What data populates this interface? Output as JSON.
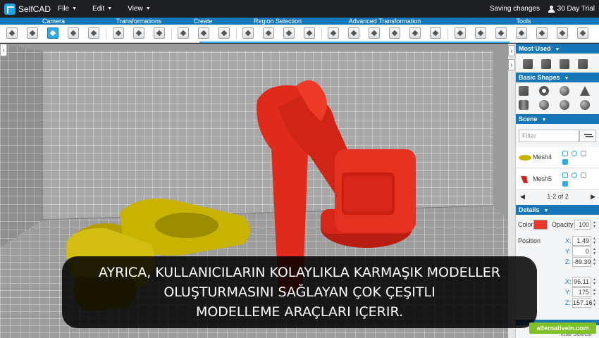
{
  "app": {
    "name": "SelfCAD"
  },
  "menu": {
    "file": "File",
    "edit": "Edit",
    "view": "View"
  },
  "status": {
    "saving": "Saving changes",
    "trial": "30 Day Trial"
  },
  "toolbar_groups": {
    "camera": "Camera",
    "transformations": "Transformations",
    "create": "Create",
    "region_selection": "Region Selection",
    "advanced_transformation": "Advanced Transformation",
    "tools": "Tools"
  },
  "panel": {
    "most_used": "Most Used",
    "basic_shapes": "Basic Shapes",
    "scene": "Scene",
    "filter_placeholder": "Filter",
    "meshes": [
      {
        "name": "Mesh4",
        "color": "#c8b400"
      },
      {
        "name": "Mesh5",
        "color": "#d8261a"
      }
    ],
    "pager": "1-2 of 2",
    "details": "Details",
    "color_label": "Color",
    "color_value": "#e8372a",
    "opacity_label": "Opacity",
    "opacity_value": "100",
    "position_label": "Position",
    "pos": {
      "x": "1.49",
      "y": "0",
      "z": "-89.39"
    },
    "size": {
      "x": "96.11",
      "y": "175",
      "z": "157.16"
    },
    "footer_text": "Total   Selecte"
  },
  "caption": {
    "line1": "AYRICA, KULLANICILARIN KOLAYLIKLA KARMAŞIK MODELLER",
    "line2": "OLUŞTURMASINI SAĞLAYAN ÇOK ÇEŞITLI",
    "line3": "MODELLEME ARAÇLARI IÇERIR."
  },
  "watermark": "alternativein.com",
  "colors": {
    "accent": "#1677b8",
    "mesh_red": "#d8261a",
    "mesh_yellow": "#c8b400"
  }
}
